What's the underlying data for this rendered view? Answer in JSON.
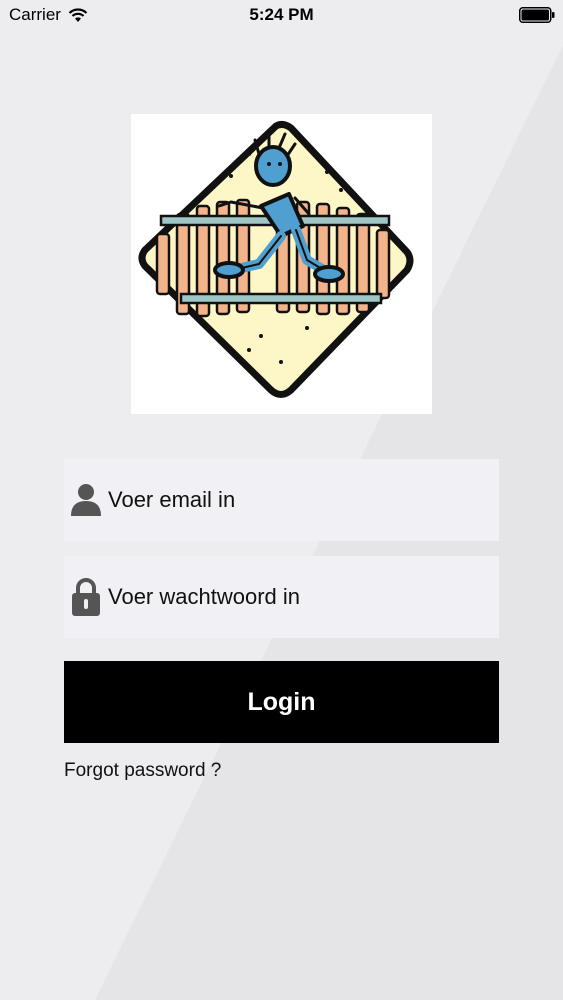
{
  "status_bar": {
    "carrier": "Carrier",
    "time": "5:24 PM",
    "wifi_icon": "wifi-icon",
    "battery_icon": "battery-icon"
  },
  "logo": {
    "icon": "railroad-crossing-pedestrian-sign",
    "colors": {
      "sign_fill": "#fdf6c6",
      "ties": "#f3b48b",
      "rails": "#9fc7c5",
      "figure": "#4f9fd0",
      "outline": "#111111"
    }
  },
  "login_form": {
    "email": {
      "placeholder": "Voer email in",
      "value": "",
      "icon": "user-icon"
    },
    "password": {
      "placeholder": "Voer wachtwoord in",
      "value": "",
      "icon": "lock-icon"
    },
    "login_label": "Login",
    "forgot_password_label": "Forgot password ?"
  },
  "colors": {
    "background": "#ededef",
    "field_background": "#f1f0f4",
    "button_background": "#000000",
    "button_text": "#ffffff"
  }
}
